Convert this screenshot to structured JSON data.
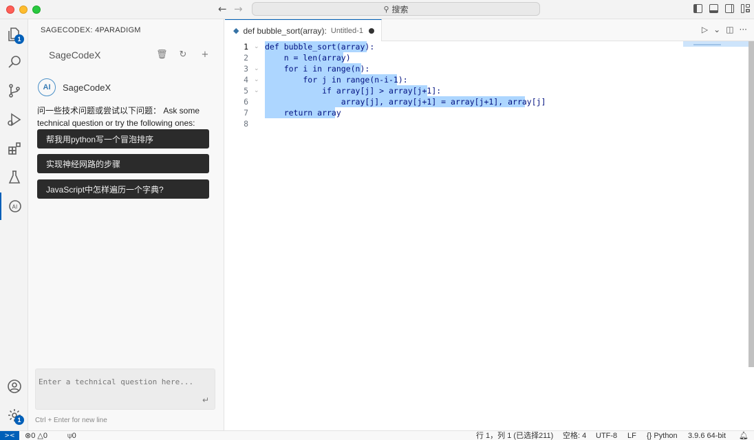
{
  "titlebar": {
    "search_label": "搜索",
    "back_glyph": "←",
    "forward_glyph": "→"
  },
  "activity": {
    "explorer_badge": "1",
    "settings_badge": "1"
  },
  "sidebar": {
    "title": "SAGECODEX: 4PARADIGM",
    "panel_title": "SageCodeX",
    "bot_logo": "AI",
    "bot_name": "SageCodeX",
    "intro": "问一些技术问题或尝试以下问题： Ask some technical question or try the following ones:",
    "suggestions": [
      "帮我用python写一个冒泡排序",
      "实现神经网路的步骤",
      "JavaScript中怎样遍历一个字典?"
    ],
    "input_placeholder": "Enter a technical question here...",
    "input_hint": "Ctrl + Enter for new line"
  },
  "editor": {
    "tab_name": "def bubble_sort(array):",
    "tab_desc": "Untitled-1",
    "lines": [
      "def bubble_sort(array):",
      "    n = len(array)",
      "    for i in range(n):",
      "        for j in range(n-i-1):",
      "            if array[j] > array[j+1]:",
      "                array[j], array[j+1] = array[j+1], array[j]",
      "    return array",
      ""
    ],
    "line_numbers": [
      "1",
      "2",
      "3",
      "4",
      "5",
      "6",
      "7",
      "8"
    ]
  },
  "statusbar": {
    "remote": "><",
    "errors": "0",
    "warnings": "0",
    "ports": "0",
    "position": "行 1，列 1 (已选择211)",
    "spaces": "空格: 4",
    "encoding": "UTF-8",
    "eol": "LF",
    "language": "Python",
    "interpreter": "3.9.6 64-bit"
  }
}
